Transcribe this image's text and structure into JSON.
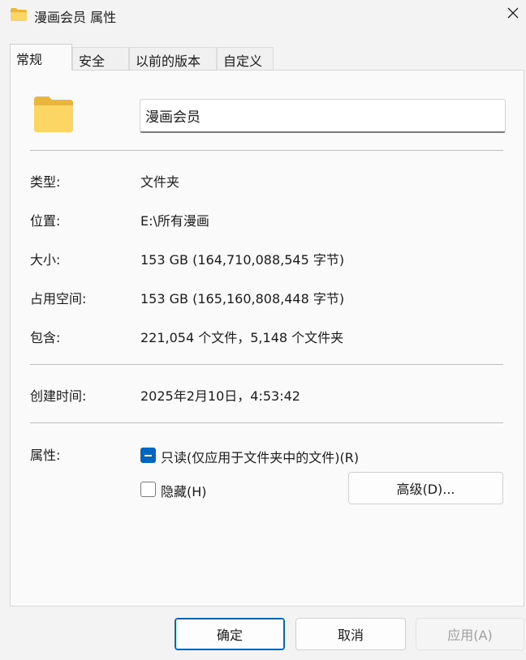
{
  "window": {
    "title": "漫画会员 属性",
    "icon": "folder-icon"
  },
  "tabs": [
    {
      "label": "常规",
      "active": true
    },
    {
      "label": "安全",
      "active": false
    },
    {
      "label": "以前的版本",
      "active": false
    },
    {
      "label": "自定义",
      "active": false
    }
  ],
  "general": {
    "name_value": "漫画会员",
    "rows": {
      "type": {
        "label": "类型:",
        "value": "文件夹"
      },
      "location": {
        "label": "位置:",
        "value": "E:\\所有漫画"
      },
      "size": {
        "label": "大小:",
        "value": "153 GB (164,710,088,545 字节)"
      },
      "size_on_disk": {
        "label": "占用空间:",
        "value": "153 GB (165,160,808,448 字节)"
      },
      "contains": {
        "label": "包含:",
        "value": "221,054 个文件，5,148 个文件夹"
      },
      "created": {
        "label": "创建时间:",
        "value": "2025年2月10日，4:53:42"
      }
    },
    "attributes": {
      "label": "属性:",
      "readonly_label": "只读(仅应用于文件夹中的文件)(R)",
      "readonly_state": "indeterminate",
      "hidden_label": "隐藏(H)",
      "hidden_checked": false,
      "advanced_label": "高级(D)..."
    }
  },
  "footer": {
    "ok_label": "确定",
    "cancel_label": "取消",
    "apply_label": "应用(A)"
  },
  "colors": {
    "accent": "#0067c0",
    "folder_yellow": "#f7c948"
  }
}
